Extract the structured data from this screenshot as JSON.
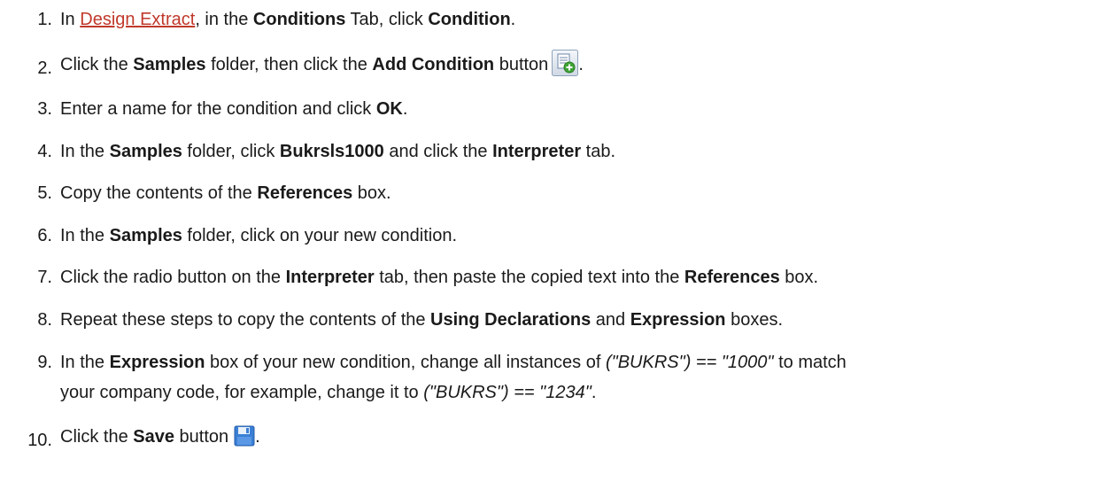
{
  "steps": [
    {
      "num": "1.",
      "p1": "In ",
      "link": "Design Extract",
      "p2": ", in the ",
      "b1": "Conditions",
      "p3": " Tab, click ",
      "b2": "Condition",
      "p4": "."
    },
    {
      "num": "2.",
      "p1": "Click the ",
      "b1": "Samples",
      "p2": " folder, then click the ",
      "b2": "Add Condition",
      "p3": " button",
      "p4": "."
    },
    {
      "num": "3.",
      "p1": "Enter a name for the condition and click ",
      "b1": "OK",
      "p2": "."
    },
    {
      "num": "4.",
      "p1": "In the ",
      "b1": "Samples",
      "p2": " folder, click ",
      "b2": "Bukrsls1000",
      "p3": " and click the ",
      "b3": "Interpreter",
      "p4": " tab."
    },
    {
      "num": "5.",
      "p1": "Copy the contents of the ",
      "b1": "References",
      "p2": " box."
    },
    {
      "num": "6.",
      "p1": "In the ",
      "b1": "Samples",
      "p2": " folder, click on your new condition."
    },
    {
      "num": "7.",
      "p1": "Click the radio button on the ",
      "b1": "Interpreter",
      "p2": " tab, then paste the copied text into the ",
      "b2": "References",
      "p3": " box."
    },
    {
      "num": "8.",
      "p1": "Repeat these steps to copy the contents of the ",
      "b1": "Using Declarations",
      "p2": " and ",
      "b2": "Expression",
      "p3": " boxes."
    },
    {
      "num": "9.",
      "p1": "In the ",
      "b1": "Expression",
      "p2": " box of your new condition, change all instances of ",
      "i1": "(\"BUKRS\") == \"1000\"",
      "p3": " to match",
      "line2_p1": "your company code, for example, change it to ",
      "line2_i1": "(\"BUKRS\") == \"1234\"",
      "line2_p2": "."
    },
    {
      "num": "10.",
      "p1": "Click the ",
      "b1": "Save",
      "p2": " button",
      "p3": "."
    }
  ],
  "icons": {
    "add_condition": "add-condition-icon",
    "save": "save-floppy-icon"
  },
  "colors": {
    "link": "#c0392b",
    "text": "#1a1a1a",
    "save_icon": "#3a7fd5",
    "add_icon_plus": "#3fa535"
  }
}
